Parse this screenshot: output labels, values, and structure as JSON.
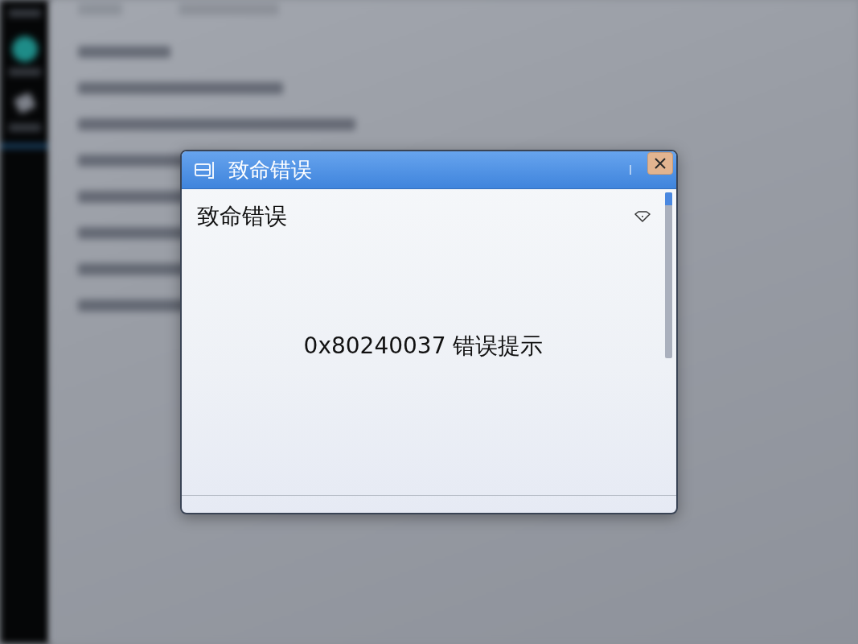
{
  "dialog": {
    "title": "致命错误",
    "heading": "致命错误",
    "message": "0x80240037 错误提示"
  }
}
